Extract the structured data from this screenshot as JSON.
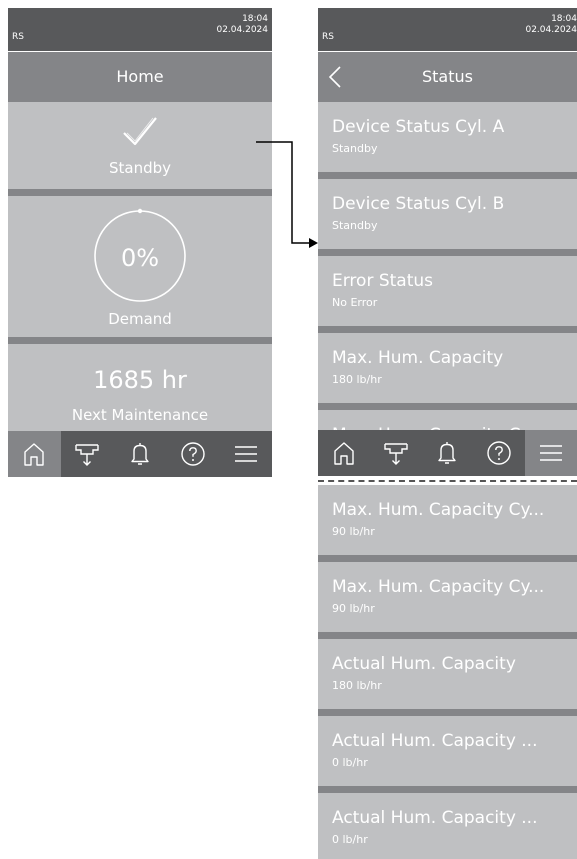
{
  "left_screen": {
    "status_bar": {
      "left_text": "RS",
      "time": "18:04",
      "date": "02.04.2024"
    },
    "title": "Home",
    "tiles": [
      {
        "label": "Standby"
      },
      {
        "value": "0%",
        "label": "Demand"
      },
      {
        "value": "1685 hr",
        "label": "Next Maintenance"
      }
    ],
    "nav": [
      "home-icon",
      "humidifier-icon",
      "bell-icon",
      "help-icon",
      "menu-icon"
    ]
  },
  "right_screen": {
    "status_bar": {
      "left_text": "RS",
      "time": "18:04",
      "date": "02.04.2024"
    },
    "title": "Status",
    "items": [
      {
        "title": "Device Status Cyl. A",
        "value": "Standby"
      },
      {
        "title": "Device Status Cyl. B",
        "value": "Standby"
      },
      {
        "title": "Error Status",
        "value": "No Error"
      },
      {
        "title": "Max. Hum. Capacity",
        "value": "180 lb/hr"
      },
      {
        "title": "Max. Hum. Capacity Cy",
        "value": ""
      }
    ],
    "continued_items": [
      {
        "title": "Max. Hum. Capacity Cy...",
        "value": "90 lb/hr"
      },
      {
        "title": "Max. Hum. Capacity Cy...",
        "value": "90 lb/hr"
      },
      {
        "title": "Actual Hum. Capacity",
        "value": "180 lb/hr"
      },
      {
        "title": "Actual Hum. Capacity ...",
        "value": "0 lb/hr"
      },
      {
        "title": "Actual Hum. Capacity ...",
        "value": "0 lb/hr"
      }
    ],
    "nav": [
      "home-icon",
      "humidifier-icon",
      "bell-icon",
      "help-icon",
      "menu-icon"
    ]
  },
  "colors": {
    "status_bar": "#58595b",
    "title_bar": "#848588",
    "tile": "#bfc0c2",
    "text": "#ffffff",
    "connector": "#000000"
  }
}
